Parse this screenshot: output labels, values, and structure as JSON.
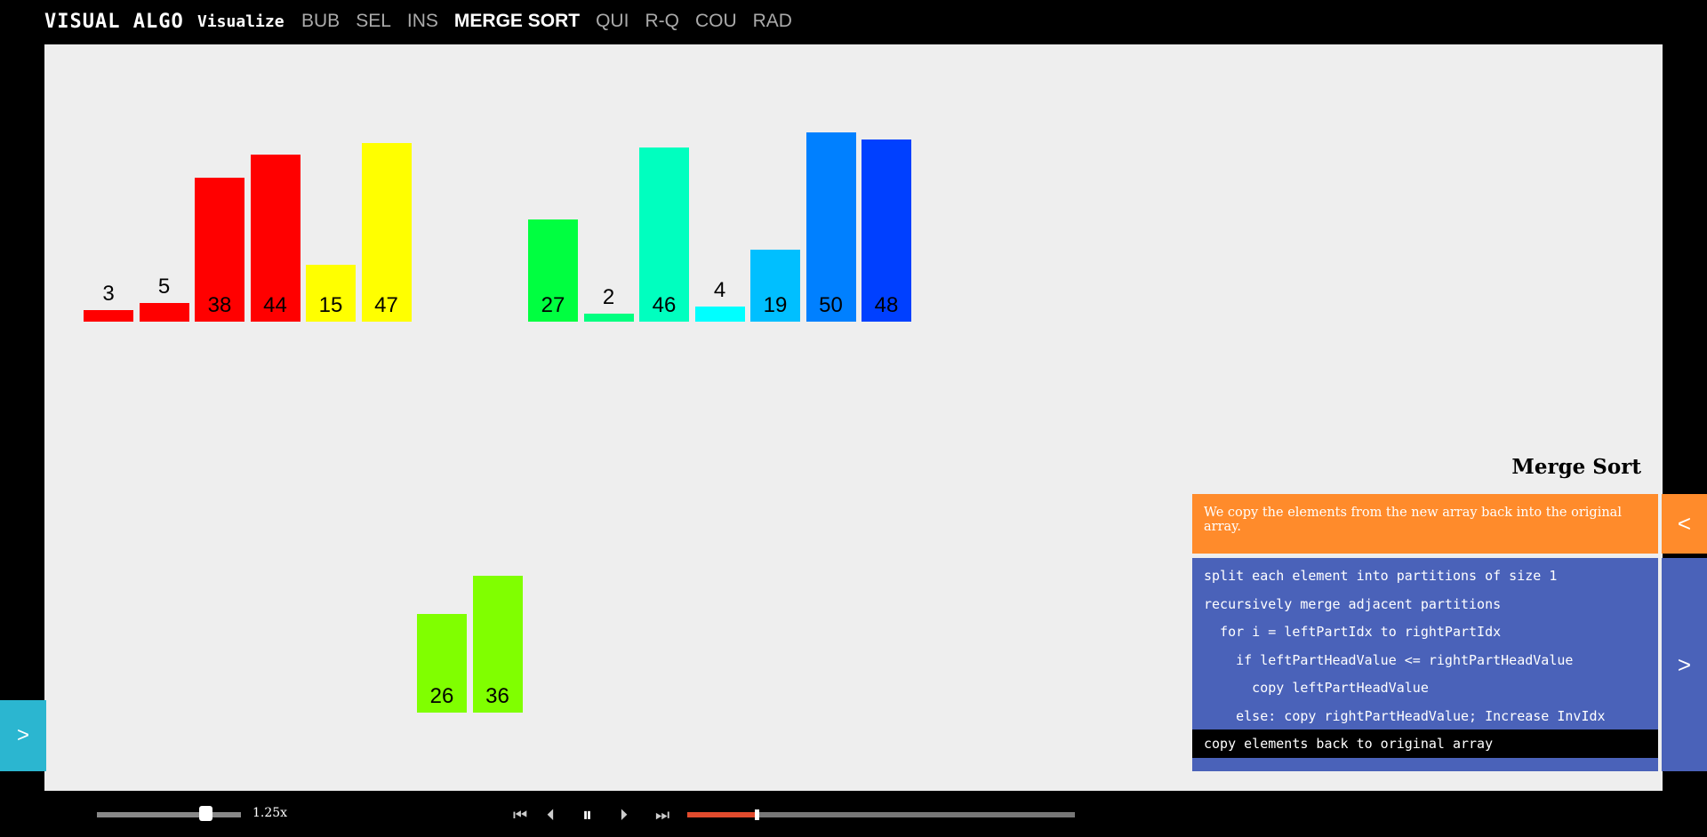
{
  "app": {
    "brand": "VISUAL ALGO",
    "visualize_label": "Visualize"
  },
  "nav": {
    "tabs": [
      {
        "label": "BUB",
        "active": false
      },
      {
        "label": "SEL",
        "active": false
      },
      {
        "label": "INS",
        "active": false
      },
      {
        "label": "MERGE SORT",
        "active": true
      },
      {
        "label": "QUI",
        "active": false
      },
      {
        "label": "R-Q",
        "active": false
      },
      {
        "label": "COU",
        "active": false
      },
      {
        "label": "RAD",
        "active": false
      }
    ]
  },
  "bars": [
    {
      "value": 3,
      "color": "#ff0000",
      "row": "top"
    },
    {
      "value": 5,
      "color": "#ff0000",
      "row": "top"
    },
    {
      "value": 38,
      "color": "#ff0000",
      "row": "top"
    },
    {
      "value": 44,
      "color": "#ff0000",
      "row": "top"
    },
    {
      "value": 15,
      "color": "#ffff00",
      "row": "top"
    },
    {
      "value": 47,
      "color": "#ffff00",
      "row": "top"
    },
    {
      "value": 26,
      "color": "#80ff00",
      "row": "bottom"
    },
    {
      "value": 36,
      "color": "#80ff00",
      "row": "bottom"
    },
    {
      "value": 27,
      "color": "#00ff40",
      "row": "top"
    },
    {
      "value": 2,
      "color": "#00ff80",
      "row": "top"
    },
    {
      "value": 46,
      "color": "#00ffbf",
      "row": "top"
    },
    {
      "value": 4,
      "color": "#00ffff",
      "row": "top"
    },
    {
      "value": 19,
      "color": "#00bfff",
      "row": "top"
    },
    {
      "value": 50,
      "color": "#0080ff",
      "row": "top"
    },
    {
      "value": 48,
      "color": "#0040ff",
      "row": "top"
    }
  ],
  "panel": {
    "title": "Merge Sort",
    "status": "We copy the elements from the new array back into the original array.",
    "status_toggle": "<",
    "code_toggle": ">",
    "code": [
      {
        "text": "split each element into partitions of size 1",
        "current": false
      },
      {
        "text": "recursively merge adjacent partitions",
        "current": false
      },
      {
        "text": "  for i = leftPartIdx to rightPartIdx",
        "current": false
      },
      {
        "text": "    if leftPartHeadValue <= rightPartHeadValue",
        "current": false
      },
      {
        "text": "      copy leftPartHeadValue",
        "current": false
      },
      {
        "text": "    else: copy rightPartHeadValue; Increase InvIdx",
        "current": false
      },
      {
        "text": "copy elements back to original array",
        "current": true
      }
    ]
  },
  "side_toggle": ">",
  "controls": {
    "speed_label": "1.25x",
    "speed_fraction": 0.75,
    "progress_fraction": 0.18,
    "icons": [
      "go-to-start-icon",
      "step-back-icon",
      "pause-icon",
      "step-forward-icon",
      "go-to-end-icon"
    ]
  }
}
